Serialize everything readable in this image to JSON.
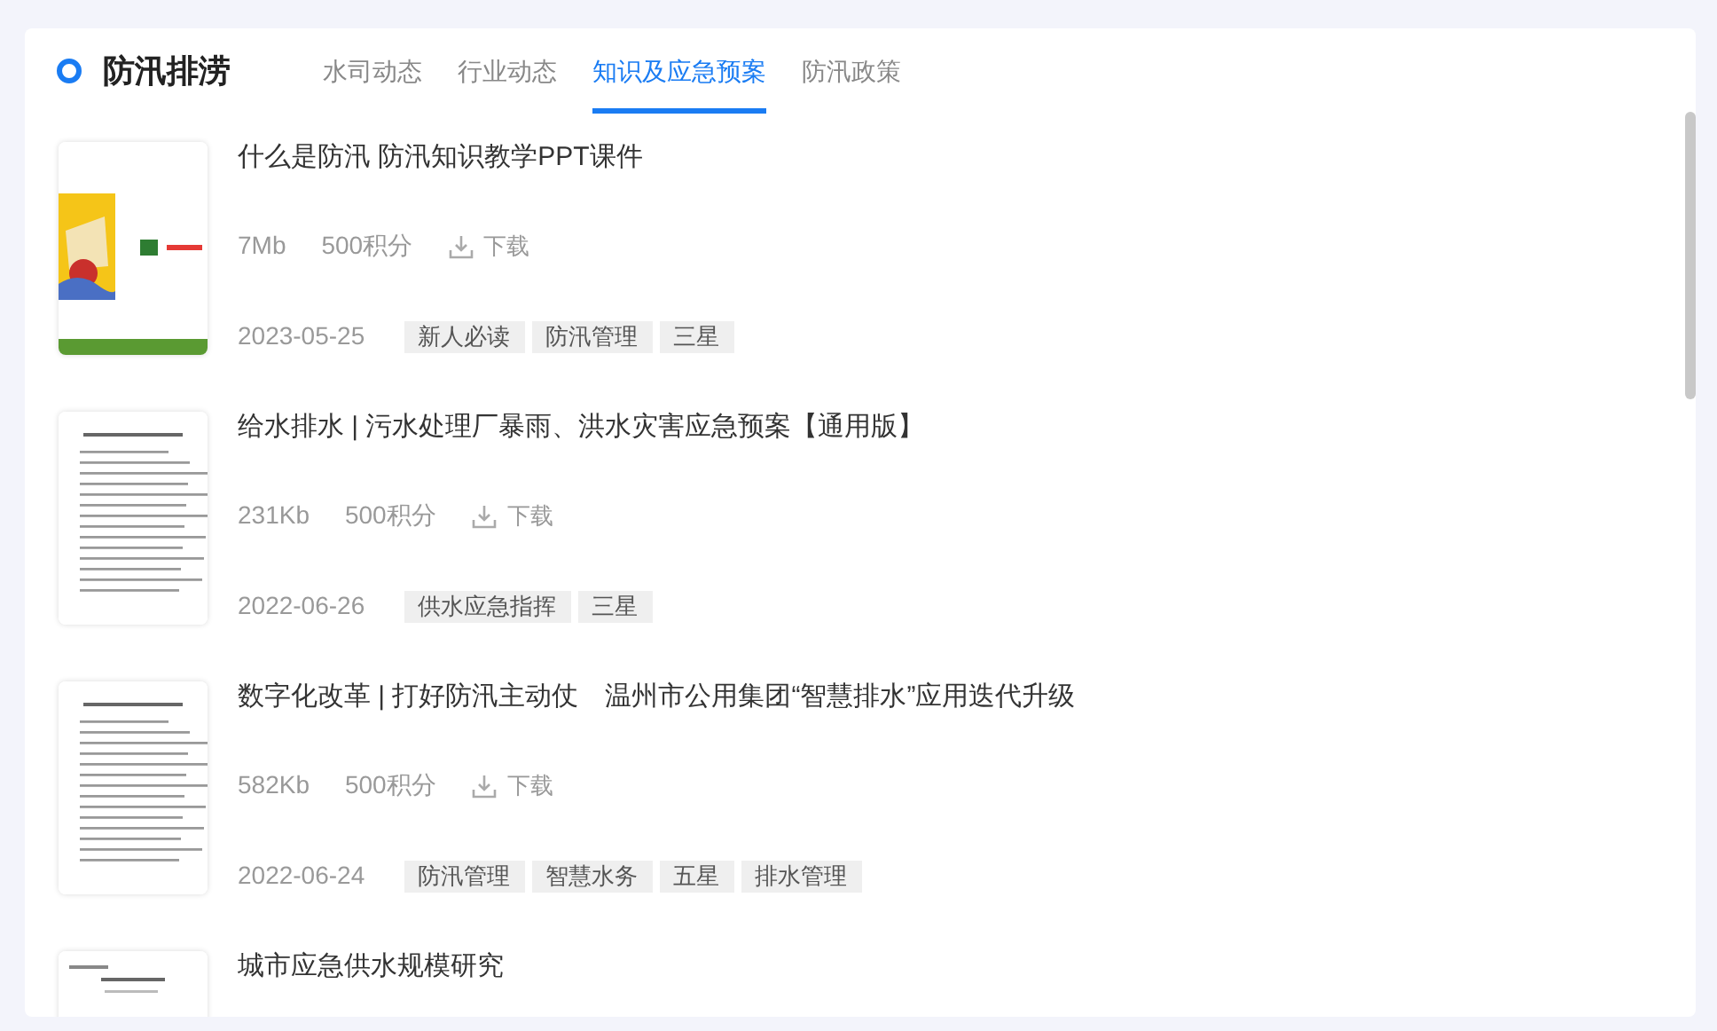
{
  "header": {
    "title": "防汛排涝"
  },
  "tabs": [
    {
      "label": "水司动态",
      "selected": false
    },
    {
      "label": "行业动态",
      "selected": false
    },
    {
      "label": "知识及应急预案",
      "selected": true
    },
    {
      "label": "防汛政策",
      "selected": false
    }
  ],
  "items": [
    {
      "kind": "slide",
      "title": "什么是防汛 防汛知识教学PPT课件",
      "size": "7Mb",
      "points": "500积分",
      "download": "下载",
      "date": "2023-05-25",
      "tags": [
        "新人必读",
        "防汛管理",
        "三星"
      ]
    },
    {
      "kind": "document",
      "title": "给水排水 | 污水处理厂暴雨、洪水灾害应急预案【通用版】",
      "size": "231Kb",
      "points": "500积分",
      "download": "下载",
      "date": "2022-06-26",
      "tags": [
        "供水应急指挥",
        "三星"
      ]
    },
    {
      "kind": "document",
      "title": "数字化改革 | 打好防汛主动仗　温州市公用集团“智慧排水”应用迭代升级",
      "size": "582Kb",
      "points": "500积分",
      "download": "下载",
      "date": "2022-06-24",
      "tags": [
        "防汛管理",
        "智慧水务",
        "五星",
        "排水管理"
      ]
    },
    {
      "kind": "cover",
      "title": "城市应急供水规模研究"
    }
  ]
}
